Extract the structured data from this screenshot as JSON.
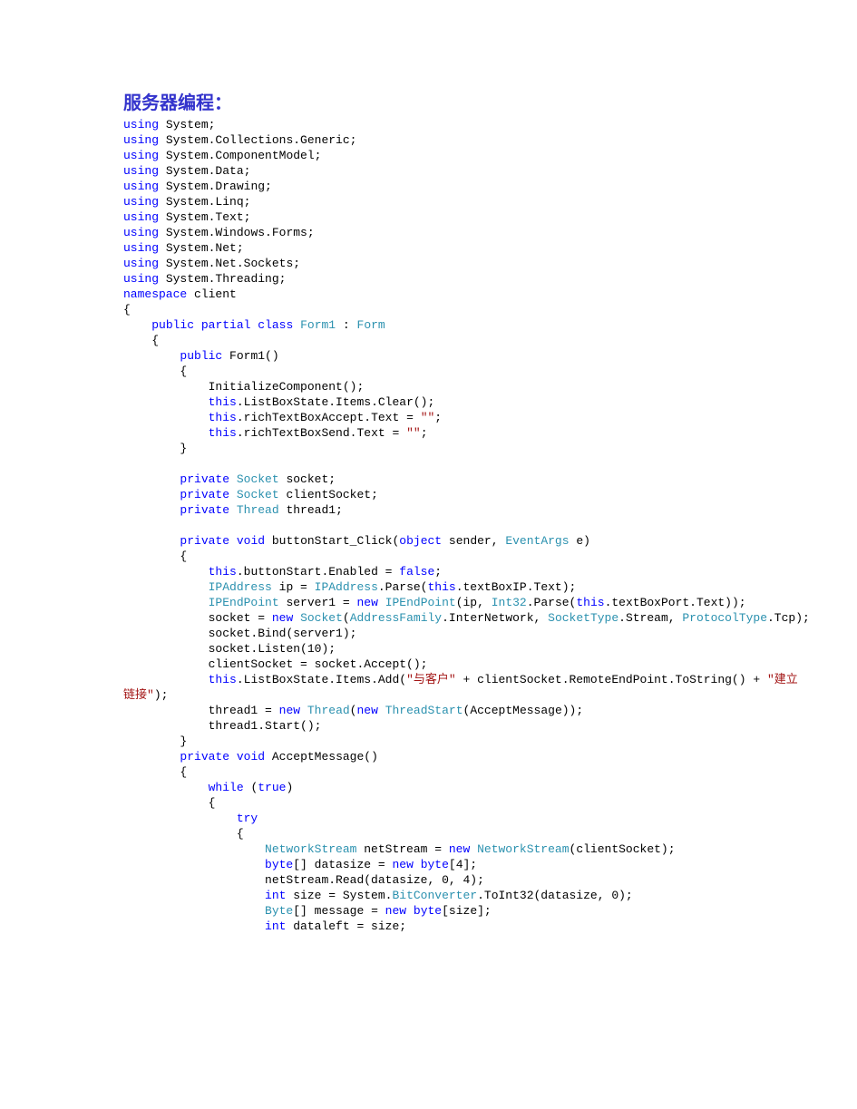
{
  "title": "服务器编程：",
  "code": {
    "kw_using": "using",
    "ns_System": "System",
    "ns_Collections_Generic": "System.Collections.Generic",
    "ns_ComponentModel": "System.ComponentModel",
    "ns_Data": "System.Data",
    "ns_Drawing": "System.Drawing",
    "ns_Linq": "System.Linq",
    "ns_Text": "System.Text",
    "ns_Windows_Forms": "System.Windows.Forms",
    "ns_Net": "System.Net",
    "ns_Net_Sockets": "System.Net.Sockets",
    "ns_Threading": "System.Threading",
    "kw_namespace": "namespace",
    "nsname": "client",
    "brace_open": "{",
    "brace_close": "}",
    "paren_close": ")",
    "semi": ";",
    "kw_public": "public",
    "kw_partial": "partial",
    "kw_class": "class",
    "type_Form1": "Form1",
    "colon": " : ",
    "type_Form": "Form",
    "ctor_name": "Form1()",
    "init_component": "InitializeComponent();",
    "kw_this": "this",
    "lb_clear": ".ListBoxState.Items.Clear();",
    "rtba": ".richTextBoxAccept.Text = ",
    "rtbs": ".richTextBoxSend.Text = ",
    "empty_str": "\"\"",
    "kw_private": "private",
    "type_Socket": "Socket",
    "fld_socket": " socket;",
    "fld_client": " clientSocket;",
    "type_Thread": "Thread",
    "fld_thread": " thread1;",
    "kw_void": "void",
    "btn_click": " buttonStart_Click(",
    "kw_object": "object",
    "sender": " sender, ",
    "type_EventArgs": "EventArgs",
    "e_paren": " e)",
    "btn_enabled": ".buttonStart.Enabled = ",
    "kw_false": "false",
    "type_IPAddress": "IPAddress",
    "ip_eq": " ip = ",
    "parse_open": ".Parse(",
    "txt_ip": ".textBoxIP.Text);",
    "type_IPEndPoint": "IPEndPoint",
    "server1_eq": " server1 = ",
    "kw_new": "new",
    "sp": " ",
    "ipep_args": "(ip, ",
    "type_Int32": "Int32",
    "parse2": ".Parse(",
    "txt_port": ".textBoxPort.Text));",
    "socket_eq": "socket = ",
    "socket_open": "(",
    "type_AddressFamily": "AddressFamily",
    "af_inter": ".InterNetwork, ",
    "type_SocketType": "SocketType",
    "st_stream": ".Stream, ",
    "type_ProtocolType": "ProtocolType",
    "pt_tcp": ".Tcp);",
    "bind": "socket.Bind(server1);",
    "listen": "socket.Listen(10);",
    "accept": "clientSocket = socket.Accept();",
    "lb_add": ".ListBoxState.Items.Add(",
    "str_client": "\"与客户\"",
    "plus_remote": " + clientSocket.RemoteEndPoint.ToString() + ",
    "str_link_a": "\"建立",
    "str_link_b": "链接\"",
    "close_paren_semi": ");",
    "thread_eq": "thread1 = ",
    "thread_open": "(",
    "type_ThreadStart": "ThreadStart",
    "ts_args": "(AcceptMessage));",
    "thread_start": "thread1.Start();",
    "method_accept": " AcceptMessage()",
    "kw_while": "while",
    "while_cond": " (",
    "kw_true": "true",
    "kw_try": "try",
    "type_NetworkStream": "NetworkStream",
    "ns_eq": " netStream = ",
    "ns_ctor": "(clientSocket);",
    "kw_byte": "byte",
    "datasize_eq": "[] datasize = ",
    "byte_arr4": "[4];",
    "ns_read": "netStream.Read(datasize, 0, 4);",
    "kw_int": "int",
    "size_eq": " size = System.",
    "type_BitConverter": "BitConverter",
    "toint32": ".ToInt32(datasize, 0);",
    "type_Byte": "Byte",
    "msg_eq": "[] message = ",
    "byte_size": "[size];",
    "dataleft": " dataleft = size;"
  }
}
